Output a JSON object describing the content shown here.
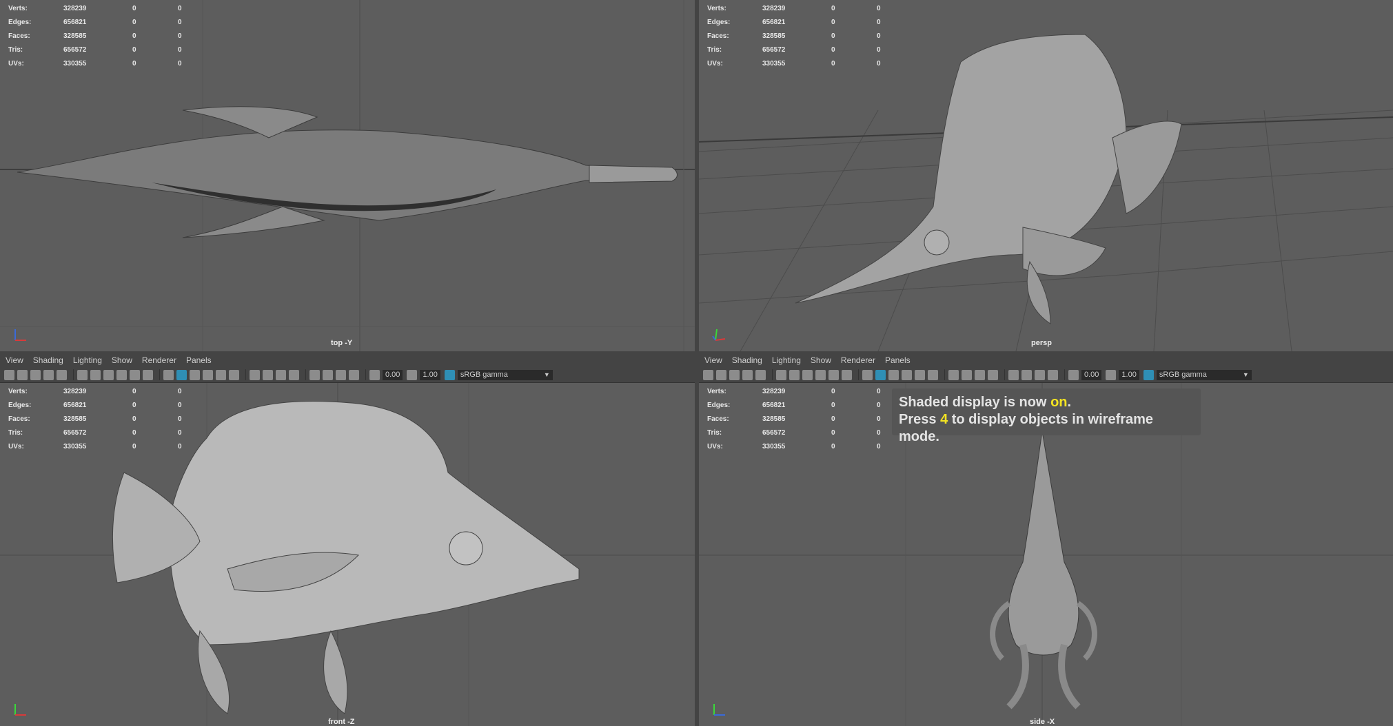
{
  "hud": {
    "rows": [
      {
        "label": "Verts:",
        "value": "328239",
        "a": "0",
        "b": "0"
      },
      {
        "label": "Edges:",
        "value": "656821",
        "a": "0",
        "b": "0"
      },
      {
        "label": "Faces:",
        "value": "328585",
        "a": "0",
        "b": "0"
      },
      {
        "label": "Tris:",
        "value": "656572",
        "a": "0",
        "b": "0"
      },
      {
        "label": "UVs:",
        "value": "330355",
        "a": "0",
        "b": "0"
      }
    ]
  },
  "menu": {
    "items": [
      "View",
      "Shading",
      "Lighting",
      "Show",
      "Renderer",
      "Panels"
    ]
  },
  "toolbar": {
    "field1": "0.00",
    "field2": "1.00",
    "color_space": "sRGB gamma"
  },
  "viewports": {
    "top": "top -Y",
    "persp": "persp",
    "front": "front -Z",
    "side": "side -X"
  },
  "toast": {
    "line1_a": "Shaded display is now ",
    "line1_hl": "on",
    "line1_b": ".",
    "line2_a": "Press ",
    "line2_hl": "4",
    "line2_b": " to display objects in wireframe mode."
  },
  "colors": {
    "viewport_bg": "#5d5d5d",
    "toolbar_bg": "#444444",
    "highlight": "#f2e322",
    "active_icon": "#2f8fb5"
  }
}
